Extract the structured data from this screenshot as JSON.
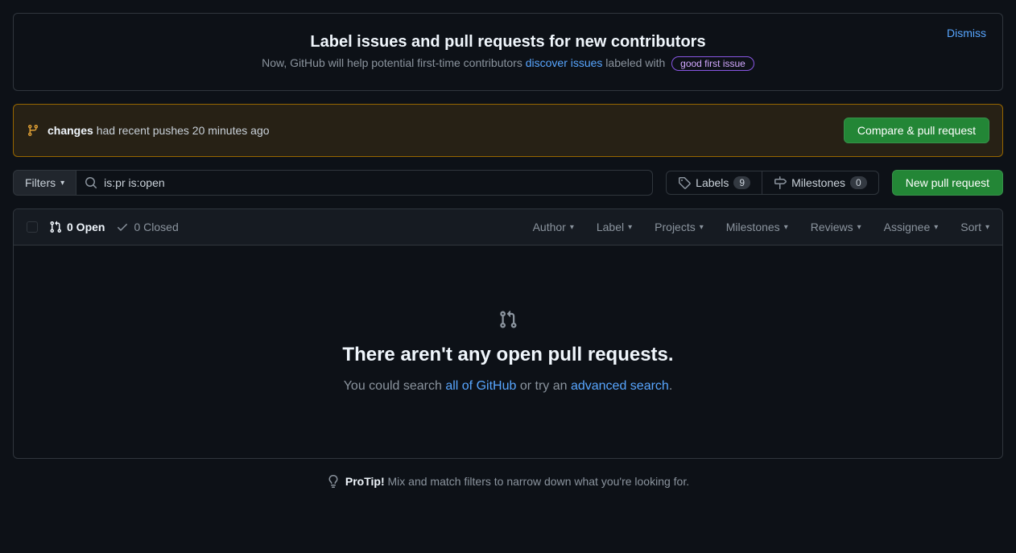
{
  "banner": {
    "title": "Label issues and pull requests for new contributors",
    "sub_prefix": "Now, GitHub will help potential first-time contributors ",
    "link_text": "discover issues",
    "sub_suffix": " labeled with ",
    "badge": "good first issue",
    "dismiss": "Dismiss"
  },
  "push": {
    "branch": "changes",
    "text": " had recent pushes 20 minutes ago",
    "button": "Compare & pull request"
  },
  "filters": {
    "button": "Filters",
    "search_value": "is:pr is:open",
    "labels": "Labels",
    "labels_count": "9",
    "milestones": "Milestones",
    "milestones_count": "0",
    "new_pr": "New pull request"
  },
  "list_header": {
    "open": "0 Open",
    "closed": "0 Closed",
    "dropdowns": [
      "Author",
      "Label",
      "Projects",
      "Milestones",
      "Reviews",
      "Assignee",
      "Sort"
    ]
  },
  "empty": {
    "title": "There aren't any open pull requests.",
    "prefix": "You could search ",
    "link1": "all of GitHub",
    "mid": " or try an ",
    "link2": "advanced search",
    "suffix": "."
  },
  "protip": {
    "bold": "ProTip!",
    "text": " Mix and match filters to narrow down what you're looking for."
  }
}
